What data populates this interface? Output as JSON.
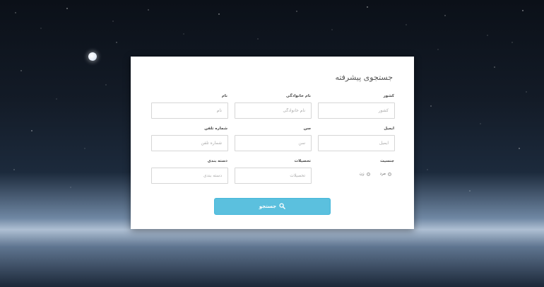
{
  "form": {
    "title": "جستجوی پیشرفته",
    "fields": {
      "country": {
        "label": "کشور",
        "placeholder": "کشور"
      },
      "last_name": {
        "label": "نام خانوادگی",
        "placeholder": "نام خانوادگی"
      },
      "first_name": {
        "label": "نام",
        "placeholder": "نام"
      },
      "email": {
        "label": "ایمیل",
        "placeholder": "ایمیل"
      },
      "age": {
        "label": "سن",
        "placeholder": "سن"
      },
      "phone": {
        "label": "شماره تلفن",
        "placeholder": "شماره تلفن"
      },
      "education": {
        "label": "تحصیلات",
        "placeholder": "تحصیلات"
      },
      "category": {
        "label": "دسته بندی",
        "placeholder": "دسته بندی"
      }
    },
    "gender": {
      "label": "جنسیت",
      "options": [
        "مرد",
        "زن"
      ]
    },
    "search_button": {
      "label": "جستجو",
      "icon": "search-icon"
    }
  },
  "colors": {
    "accent": "#5bc0de",
    "card": "#ffffff"
  }
}
